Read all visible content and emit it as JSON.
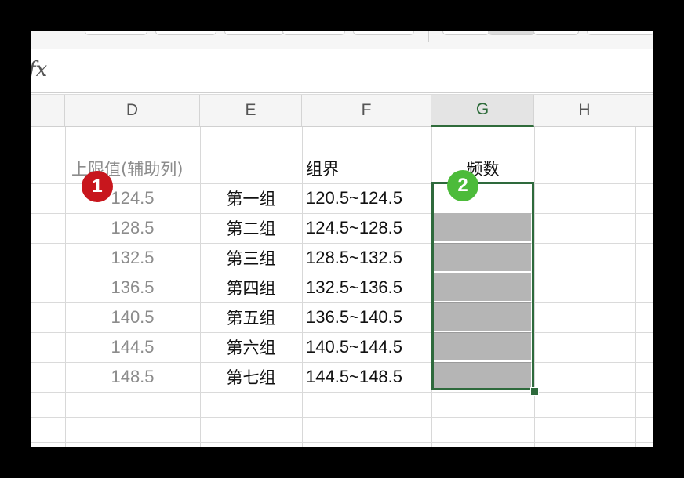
{
  "toolbar": {
    "label": ""
  },
  "formula_bar": {
    "fx_label": "fx",
    "value": ""
  },
  "columns": [
    {
      "letter": "D"
    },
    {
      "letter": "E"
    },
    {
      "letter": "F"
    },
    {
      "letter": "G"
    },
    {
      "letter": "H"
    }
  ],
  "headers": {
    "d": "上限值(辅助列)",
    "f": "组界",
    "g": "频数"
  },
  "rows": [
    {
      "d": "124.5",
      "e": "第一组",
      "f": "120.5~124.5"
    },
    {
      "d": "128.5",
      "e": "第二组",
      "f": "124.5~128.5"
    },
    {
      "d": "132.5",
      "e": "第三组",
      "f": "128.5~132.5"
    },
    {
      "d": "136.5",
      "e": "第四组",
      "f": "132.5~136.5"
    },
    {
      "d": "140.5",
      "e": "第五组",
      "f": "136.5~140.5"
    },
    {
      "d": "144.5",
      "e": "第六组",
      "f": "140.5~144.5"
    },
    {
      "d": "148.5",
      "e": "第七组",
      "f": "144.5~148.5"
    }
  ],
  "badges": {
    "one": "1",
    "two": "2"
  },
  "colors": {
    "accent": "#2e6a3c",
    "badge_red": "#c8161d",
    "badge_green": "#4cbb3a",
    "selection_fill": "#b5b5b5"
  }
}
